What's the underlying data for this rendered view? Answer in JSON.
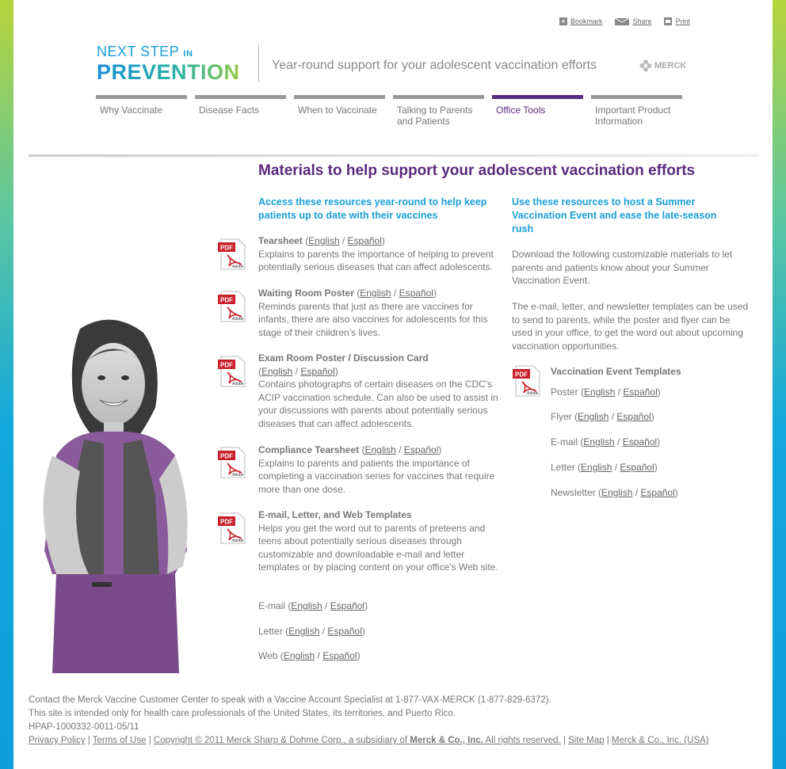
{
  "utility": {
    "bookmark": "Bookmark",
    "share": "Share",
    "print": "Print"
  },
  "logo": {
    "line1": "NEXT STEP",
    "line1_small": "IN",
    "line2": "PREVENTION"
  },
  "tagline": "Year-round support for your adolescent vaccination efforts",
  "brand": "MERCK",
  "nav": [
    {
      "label": "Why Vaccinate"
    },
    {
      "label": "Disease Facts"
    },
    {
      "label": "When to Vaccinate"
    },
    {
      "label": "Talking to Parents and Patients"
    },
    {
      "label": "Office Tools",
      "active": true
    },
    {
      "label": "Important Product Information"
    }
  ],
  "main": {
    "title": "Materials to help support your adolescent vaccination efforts",
    "left_heading": "Access these resources year-round to help keep patients up to date with their vaccines",
    "right_heading": "Use these resources to host a Summer Vaccination Event and ease the late-season rush",
    "english": "English",
    "espanol": "Español",
    "resources": [
      {
        "title": "Tearsheet",
        "desc": "Explains to parents the importance of helping to prevent potentially serious diseases that can affect adolescents."
      },
      {
        "title": "Waiting Room Poster",
        "desc": "Reminds parents that just as there are vaccines for infants, there are also vaccines for adolescents for this stage of their children’s lives."
      },
      {
        "title": "Exam Room Poster / Discussion Card",
        "desc": "Contains photographs of certain diseases on the CDC's ACIP vaccination schedule. Can also be used to assist in your discussions with parents about potentially serious diseases that can affect adolescents."
      },
      {
        "title": "Compliance Tearsheet",
        "desc": "Explains to parents and patients the importance of completing a vaccination series for vaccines that require more than one dose."
      },
      {
        "title": "E-mail, Letter, and Web Templates",
        "desc": "Helps you get the word out to parents of preteens and teens about potentially serious diseases through customizable and downloadable e-mail and letter templates or by placing content on your office's Web site."
      }
    ],
    "template_links": [
      "E-mail",
      "Letter",
      "Web"
    ],
    "right_p1": "Download the following customizable materials to let parents and patients know about your Summer Vaccination Event.",
    "right_p2": "The e-mail, letter, and newsletter templates can be used to send to parents, while the poster and flyer can be used in your office, to get the word out about upcoming vaccination opportunities.",
    "event_title": "Vaccination Event Templates",
    "event_links": [
      "Poster",
      "Flyer",
      "E-mail",
      "Letter",
      "Newsletter"
    ]
  },
  "footer": {
    "line1": "Contact the Merck Vaccine Customer Center to speak with a Vaccine Account Specialist at 1-877-VAX-MERCK (1-877-829-6372).",
    "line2": "This site is intended only for health care professionals of the United States, its territories, and Puerto Rico.",
    "code": "HPAP-1000332-0011-05/11",
    "privacy": "Privacy Policy",
    "terms": "Terms of Use",
    "copyright_pre": "Copyright © 2011 Merck Sharp & Dohme Corp., a subsidiary of ",
    "copyright_bold": "Merck & Co., Inc.",
    "copyright_post": " All rights reserved.",
    "sitemap": "Site Map",
    "merck_usa": "Merck & Co., Inc. (USA)"
  },
  "colors": {
    "purple": "#5a2a7e",
    "blue": "#1a9fd8",
    "pdf_red": "#c8202a"
  }
}
